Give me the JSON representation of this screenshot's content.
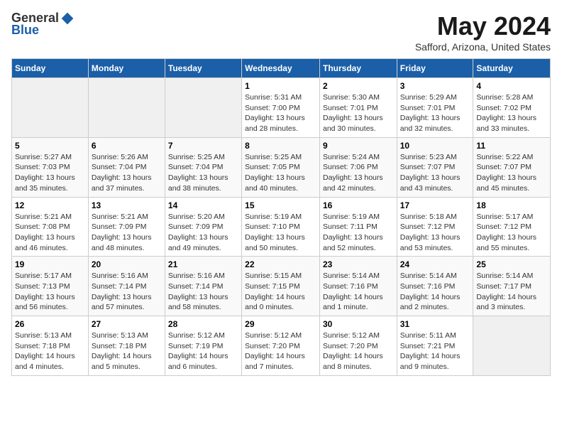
{
  "header": {
    "logo_general": "General",
    "logo_blue": "Blue",
    "month_title": "May 2024",
    "location": "Safford, Arizona, United States"
  },
  "days_of_week": [
    "Sunday",
    "Monday",
    "Tuesday",
    "Wednesday",
    "Thursday",
    "Friday",
    "Saturday"
  ],
  "weeks": [
    [
      {
        "day": null,
        "info": null
      },
      {
        "day": null,
        "info": null
      },
      {
        "day": null,
        "info": null
      },
      {
        "day": "1",
        "info": "Sunrise: 5:31 AM\nSunset: 7:00 PM\nDaylight: 13 hours\nand 28 minutes."
      },
      {
        "day": "2",
        "info": "Sunrise: 5:30 AM\nSunset: 7:01 PM\nDaylight: 13 hours\nand 30 minutes."
      },
      {
        "day": "3",
        "info": "Sunrise: 5:29 AM\nSunset: 7:01 PM\nDaylight: 13 hours\nand 32 minutes."
      },
      {
        "day": "4",
        "info": "Sunrise: 5:28 AM\nSunset: 7:02 PM\nDaylight: 13 hours\nand 33 minutes."
      }
    ],
    [
      {
        "day": "5",
        "info": "Sunrise: 5:27 AM\nSunset: 7:03 PM\nDaylight: 13 hours\nand 35 minutes."
      },
      {
        "day": "6",
        "info": "Sunrise: 5:26 AM\nSunset: 7:04 PM\nDaylight: 13 hours\nand 37 minutes."
      },
      {
        "day": "7",
        "info": "Sunrise: 5:25 AM\nSunset: 7:04 PM\nDaylight: 13 hours\nand 38 minutes."
      },
      {
        "day": "8",
        "info": "Sunrise: 5:25 AM\nSunset: 7:05 PM\nDaylight: 13 hours\nand 40 minutes."
      },
      {
        "day": "9",
        "info": "Sunrise: 5:24 AM\nSunset: 7:06 PM\nDaylight: 13 hours\nand 42 minutes."
      },
      {
        "day": "10",
        "info": "Sunrise: 5:23 AM\nSunset: 7:07 PM\nDaylight: 13 hours\nand 43 minutes."
      },
      {
        "day": "11",
        "info": "Sunrise: 5:22 AM\nSunset: 7:07 PM\nDaylight: 13 hours\nand 45 minutes."
      }
    ],
    [
      {
        "day": "12",
        "info": "Sunrise: 5:21 AM\nSunset: 7:08 PM\nDaylight: 13 hours\nand 46 minutes."
      },
      {
        "day": "13",
        "info": "Sunrise: 5:21 AM\nSunset: 7:09 PM\nDaylight: 13 hours\nand 48 minutes."
      },
      {
        "day": "14",
        "info": "Sunrise: 5:20 AM\nSunset: 7:09 PM\nDaylight: 13 hours\nand 49 minutes."
      },
      {
        "day": "15",
        "info": "Sunrise: 5:19 AM\nSunset: 7:10 PM\nDaylight: 13 hours\nand 50 minutes."
      },
      {
        "day": "16",
        "info": "Sunrise: 5:19 AM\nSunset: 7:11 PM\nDaylight: 13 hours\nand 52 minutes."
      },
      {
        "day": "17",
        "info": "Sunrise: 5:18 AM\nSunset: 7:12 PM\nDaylight: 13 hours\nand 53 minutes."
      },
      {
        "day": "18",
        "info": "Sunrise: 5:17 AM\nSunset: 7:12 PM\nDaylight: 13 hours\nand 55 minutes."
      }
    ],
    [
      {
        "day": "19",
        "info": "Sunrise: 5:17 AM\nSunset: 7:13 PM\nDaylight: 13 hours\nand 56 minutes."
      },
      {
        "day": "20",
        "info": "Sunrise: 5:16 AM\nSunset: 7:14 PM\nDaylight: 13 hours\nand 57 minutes."
      },
      {
        "day": "21",
        "info": "Sunrise: 5:16 AM\nSunset: 7:14 PM\nDaylight: 13 hours\nand 58 minutes."
      },
      {
        "day": "22",
        "info": "Sunrise: 5:15 AM\nSunset: 7:15 PM\nDaylight: 14 hours\nand 0 minutes."
      },
      {
        "day": "23",
        "info": "Sunrise: 5:14 AM\nSunset: 7:16 PM\nDaylight: 14 hours\nand 1 minute."
      },
      {
        "day": "24",
        "info": "Sunrise: 5:14 AM\nSunset: 7:16 PM\nDaylight: 14 hours\nand 2 minutes."
      },
      {
        "day": "25",
        "info": "Sunrise: 5:14 AM\nSunset: 7:17 PM\nDaylight: 14 hours\nand 3 minutes."
      }
    ],
    [
      {
        "day": "26",
        "info": "Sunrise: 5:13 AM\nSunset: 7:18 PM\nDaylight: 14 hours\nand 4 minutes."
      },
      {
        "day": "27",
        "info": "Sunrise: 5:13 AM\nSunset: 7:18 PM\nDaylight: 14 hours\nand 5 minutes."
      },
      {
        "day": "28",
        "info": "Sunrise: 5:12 AM\nSunset: 7:19 PM\nDaylight: 14 hours\nand 6 minutes."
      },
      {
        "day": "29",
        "info": "Sunrise: 5:12 AM\nSunset: 7:20 PM\nDaylight: 14 hours\nand 7 minutes."
      },
      {
        "day": "30",
        "info": "Sunrise: 5:12 AM\nSunset: 7:20 PM\nDaylight: 14 hours\nand 8 minutes."
      },
      {
        "day": "31",
        "info": "Sunrise: 5:11 AM\nSunset: 7:21 PM\nDaylight: 14 hours\nand 9 minutes."
      },
      {
        "day": null,
        "info": null
      }
    ]
  ]
}
